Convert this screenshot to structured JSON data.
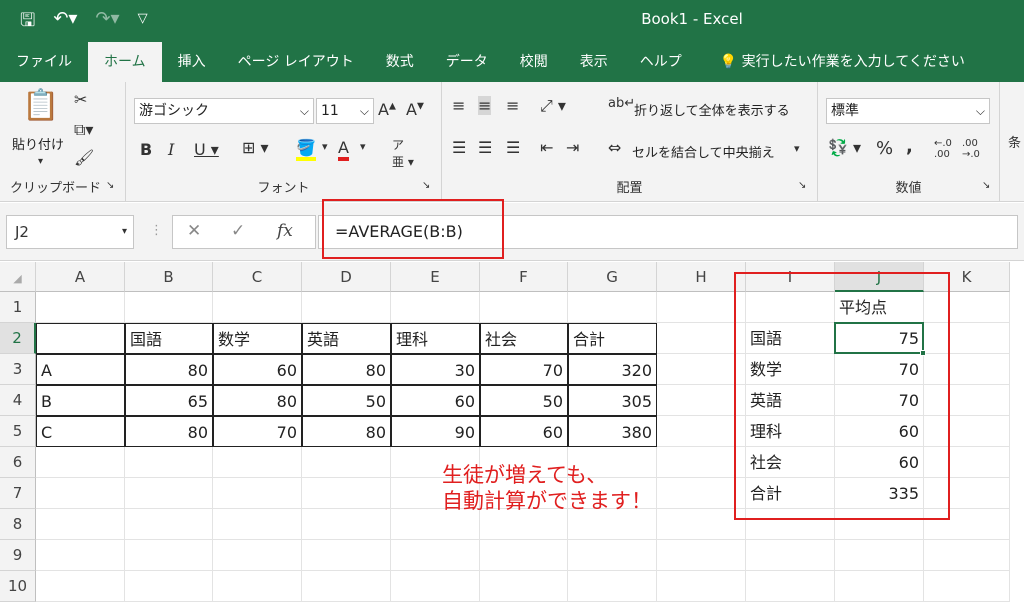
{
  "window": {
    "title": "Book1  -  Excel"
  },
  "tabs": [
    "ファイル",
    "ホーム",
    "挿入",
    "ページ レイアウト",
    "数式",
    "データ",
    "校閲",
    "表示",
    "ヘルプ"
  ],
  "tellme": "実行したい作業を入力してください",
  "ribbon": {
    "clipboard": {
      "paste": "貼り付け",
      "label": "クリップボード"
    },
    "font": {
      "name": "游ゴシック",
      "size": "11",
      "label": "フォント"
    },
    "alignment": {
      "wrap": "折り返して全体を表示する",
      "merge": "セルを結合して中央揃え",
      "label": "配置"
    },
    "number": {
      "format": "標準",
      "label": "数値"
    }
  },
  "formula_bar": {
    "namebox": "J2",
    "formula": "=AVERAGE(B:B)"
  },
  "columns": [
    "A",
    "B",
    "C",
    "D",
    "E",
    "F",
    "G",
    "H",
    "I",
    "J",
    "K"
  ],
  "rows": [
    "1",
    "2",
    "3",
    "4",
    "5",
    "6",
    "7",
    "8",
    "9",
    "10"
  ],
  "table": {
    "header": [
      "",
      "国語",
      "数学",
      "英語",
      "理科",
      "社会",
      "合計"
    ],
    "rows": [
      [
        "A",
        "80",
        "60",
        "80",
        "30",
        "70",
        "320"
      ],
      [
        "B",
        "65",
        "80",
        "50",
        "60",
        "50",
        "305"
      ],
      [
        "C",
        "80",
        "70",
        "80",
        "90",
        "60",
        "380"
      ]
    ]
  },
  "summary": {
    "header": "平均点",
    "rows": [
      [
        "国語",
        "75"
      ],
      [
        "数学",
        "70"
      ],
      [
        "英語",
        "70"
      ],
      [
        "理科",
        "60"
      ],
      [
        "社会",
        "60"
      ],
      [
        "合計",
        "335"
      ]
    ]
  },
  "annotation": {
    "line1": "生徒が増えても、",
    "line2": "自動計算ができます！"
  },
  "colors": {
    "excel_green": "#217346",
    "highlight_red": "#e01f1f"
  }
}
